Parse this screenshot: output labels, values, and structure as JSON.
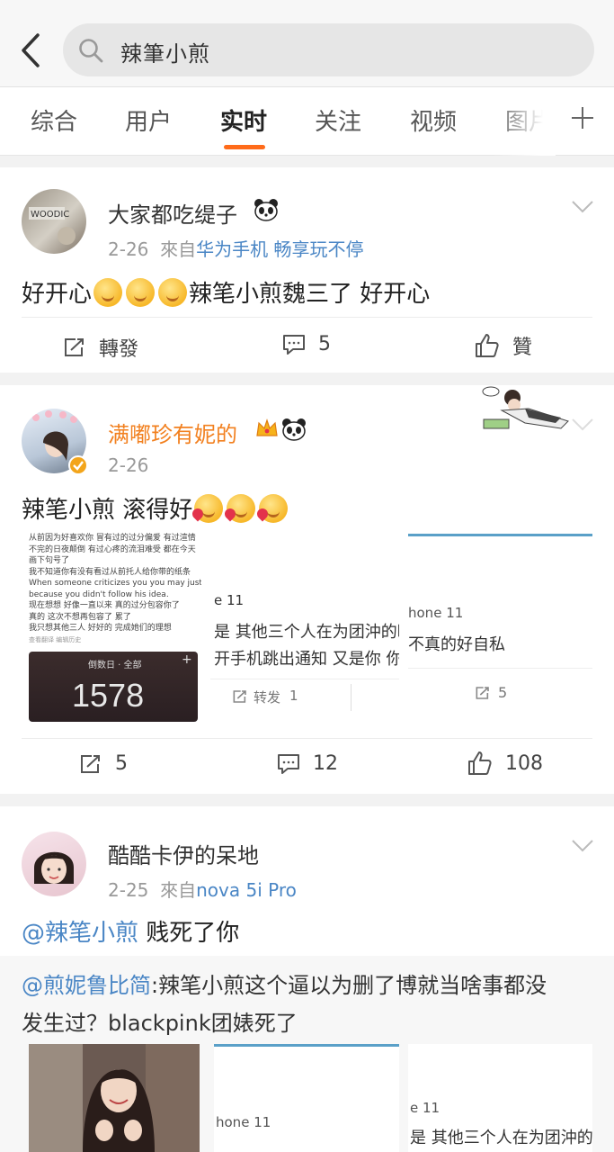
{
  "search": {
    "query": "辣筆小煎"
  },
  "tabs": [
    "综合",
    "用户",
    "实时",
    "关注",
    "视频",
    "图片"
  ],
  "active_tab": "实时",
  "posts": [
    {
      "user": "大家都吃缇子",
      "badge_icon": "panda-icon",
      "date": "2-26",
      "source_prefix": "來自",
      "source": "华为手机 畅享玩不停",
      "text": "好开心",
      "text_after": "辣笔小煎魏三了 好开心",
      "actions": {
        "repost": "轉發",
        "comment": "5",
        "like": "贊"
      }
    },
    {
      "user": "满嘟珍有妮的",
      "date": "2-26",
      "text": "辣笔小煎 滚得好",
      "images": {
        "note_lines": [
          "从前因为好喜欢你 冒有过的过分偏爱 有过渲情",
          "不完的日夜颠倒 有过心疼的流泪难受 都在今天",
          "画下句号了",
          "我不知道你有没有看过从前托人给你带的纸条",
          "When someone criticizes you you may just",
          "because you didn't follow his idea.",
          "现在想想 好像一直以来 真的过分包容你了",
          "真的 这次不想再包容了 累了",
          "我只想其他三人 好好的 完成她们的理想",
          "查看翻译   编辑历史"
        ],
        "countdown_label": "倒数日 · 全部",
        "countdown_value": "1578",
        "tile2_phone": "e 11",
        "tile2_line1": "是 其他三个人在为团沖的時",
        "tile2_line2": "开手机跳出通知 又是你 你",
        "tile2_repost": "转发",
        "tile2_repost_count": "1",
        "tile3_phone": "hone 11",
        "tile3_line1": "不真的好自私",
        "tile3_repost_count": "5"
      },
      "actions": {
        "repost": "5",
        "comment": "12",
        "like": "108"
      }
    },
    {
      "user": "酷酷卡伊的呆地",
      "date": "2-25",
      "source_prefix": "來自",
      "source": "nova 5i Pro",
      "mention": "@辣笔小煎",
      "text": "贱死了你",
      "retweet": {
        "mention": "@煎妮鲁比简",
        "text_line1": ":辣笔小煎这个逼以为删了博就当啥事都没",
        "text_line2": "发生过？blackpink团婊死了",
        "tile2_phone": "hone 11",
        "tile3_phone": "e 11",
        "tile3_line1": "是 其他三个人在为团沖的時"
      }
    }
  ]
}
